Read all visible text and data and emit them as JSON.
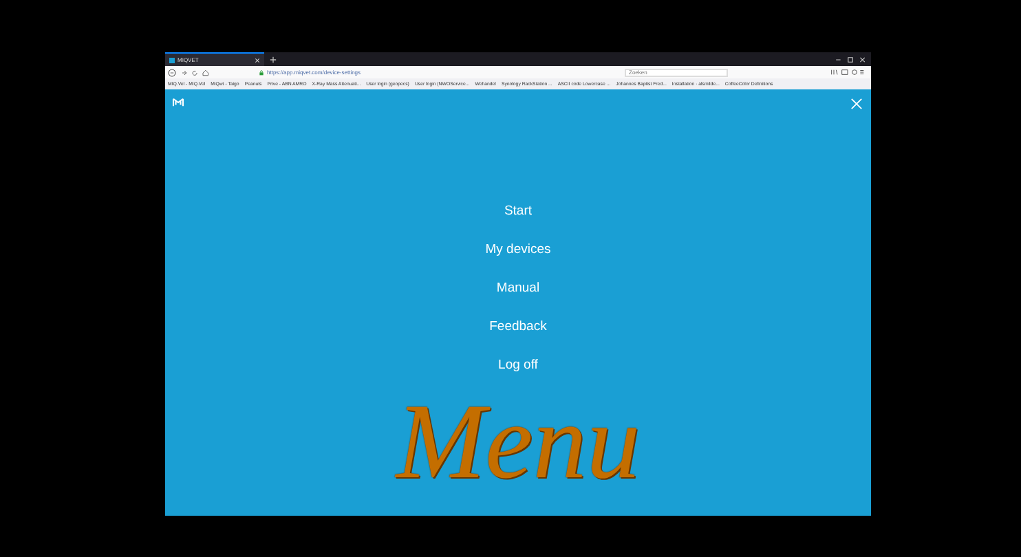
{
  "browser": {
    "tab_title": "MIQVET",
    "url": "https://app.miqvet.com/device-settings",
    "search": {
      "placeholder": "Zoeken"
    },
    "bookmarks": [
      "MIQ.Vel - MIQ.Vel",
      "MiQwt - Taigo",
      "Peanuts",
      "Prive - ABN AMRO",
      "X-Ray Mass Attenuati...",
      "User login (geopecs)",
      "User login (NWOService...",
      "Wehandel",
      "Synology RackStation ...",
      "ASCII code Lowercase ...",
      "Johannes Baptist Fred...",
      "Installation · alsmilde...",
      "CoffeeColor Definitions"
    ]
  },
  "menu": {
    "items": [
      {
        "label": "Start"
      },
      {
        "label": "My devices"
      },
      {
        "label": "Manual"
      },
      {
        "label": "Feedback"
      },
      {
        "label": "Log off"
      }
    ],
    "caption": "Menu"
  }
}
